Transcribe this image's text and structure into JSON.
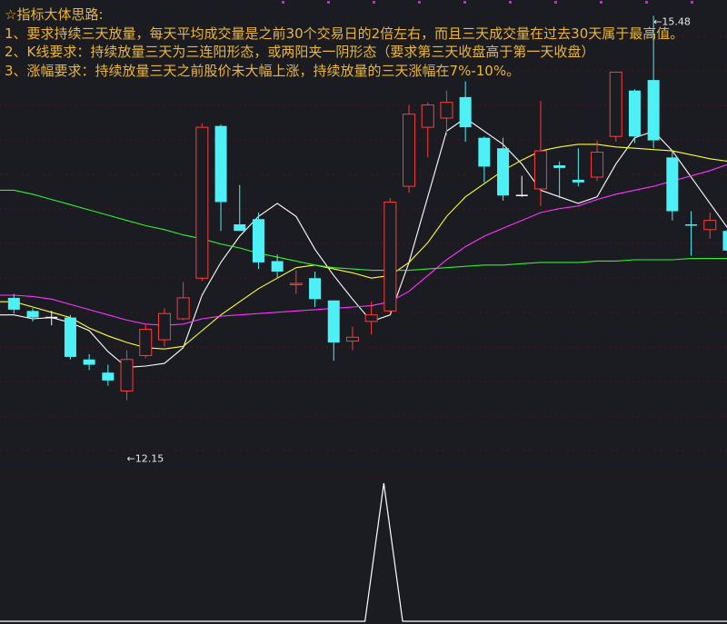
{
  "notes": {
    "title": "☆指标大体思路:",
    "line1": "1、要求持续三天放量，每天平均成交量是之前30个交易日的2倍左右，而且三天成交量在过去30天属于最高值。",
    "line2": "2、K线要求：持续放量三天为三连阳形态，或两阳夹一阴形态（要求第三天收盘高于第一天收盘）",
    "line3": "3、涨幅要求：持续放量三天之前股价未大幅上涨，持续放量的三天涨幅在7%-10%。"
  },
  "colors": {
    "background": "#1b1c21",
    "up": "#ff3b3b",
    "down": "#4df0f5",
    "text": "#e8b63a",
    "ma5": "#ffffff",
    "ma10": "#ffff33",
    "ma20": "#ff33ff",
    "ma60": "#33ee33",
    "grid": "#b01818"
  },
  "chart_data": [
    {
      "type": "candlestick",
      "ylim": [
        12.0,
        15.6
      ],
      "grid": true,
      "annotations": [
        {
          "label": "12.15",
          "value": 12.15,
          "candle": 6
        },
        {
          "label": "15.48",
          "value": 15.48,
          "candle": 34
        }
      ],
      "candles": [
        {
          "open": 13.33,
          "close": 13.24,
          "high": 13.36,
          "low": 13.21
        },
        {
          "open": 13.23,
          "close": 13.18,
          "high": 13.25,
          "low": 13.15
        },
        {
          "open": 13.18,
          "close": 13.18,
          "high": 13.23,
          "low": 13.12
        },
        {
          "open": 13.18,
          "close": 12.88,
          "high": 13.2,
          "low": 12.86
        },
        {
          "open": 12.86,
          "close": 12.82,
          "high": 12.9,
          "low": 12.78
        },
        {
          "open": 12.76,
          "close": 12.7,
          "high": 12.82,
          "low": 12.66
        },
        {
          "open": 12.62,
          "close": 12.86,
          "high": 12.93,
          "low": 12.55
        },
        {
          "open": 12.89,
          "close": 13.09,
          "high": 13.13,
          "low": 12.87
        },
        {
          "open": 13.01,
          "close": 13.21,
          "high": 13.25,
          "low": 12.96
        },
        {
          "open": 13.17,
          "close": 13.33,
          "high": 13.45,
          "low": 13.16
        },
        {
          "open": 13.48,
          "close": 14.63,
          "high": 14.66,
          "low": 13.46
        },
        {
          "open": 14.64,
          "close": 14.06,
          "high": 14.65,
          "low": 13.84
        },
        {
          "open": 13.89,
          "close": 13.84,
          "high": 14.19,
          "low": 13.84
        },
        {
          "open": 13.93,
          "close": 13.6,
          "high": 13.98,
          "low": 13.55
        },
        {
          "open": 13.61,
          "close": 13.53,
          "high": 13.66,
          "low": 13.48
        },
        {
          "open": 13.43,
          "close": 13.44,
          "high": 13.54,
          "low": 13.36
        },
        {
          "open": 13.48,
          "close": 13.32,
          "high": 13.53,
          "low": 13.26
        },
        {
          "open": 13.31,
          "close": 12.99,
          "high": 13.31,
          "low": 12.85
        },
        {
          "open": 13.0,
          "close": 13.03,
          "high": 13.11,
          "low": 12.93
        },
        {
          "open": 13.15,
          "close": 13.2,
          "high": 13.3,
          "low": 13.05
        },
        {
          "open": 13.23,
          "close": 14.06,
          "high": 14.09,
          "low": 13.22
        },
        {
          "open": 14.18,
          "close": 14.73,
          "high": 14.8,
          "low": 14.13
        },
        {
          "open": 14.63,
          "close": 14.8,
          "high": 14.82,
          "low": 14.4
        },
        {
          "open": 14.7,
          "close": 14.82,
          "high": 14.91,
          "low": 14.57
        },
        {
          "open": 14.86,
          "close": 14.63,
          "high": 14.98,
          "low": 14.52
        },
        {
          "open": 14.55,
          "close": 14.33,
          "high": 14.56,
          "low": 14.21
        },
        {
          "open": 14.47,
          "close": 14.11,
          "high": 14.55,
          "low": 14.07
        },
        {
          "open": 14.11,
          "close": 14.11,
          "high": 14.26,
          "low": 14.1
        },
        {
          "open": 14.16,
          "close": 14.45,
          "high": 14.83,
          "low": 14.03
        },
        {
          "open": 14.34,
          "close": 14.32,
          "high": 14.37,
          "low": 14.09
        },
        {
          "open": 14.23,
          "close": 14.21,
          "high": 14.47,
          "low": 14.18
        },
        {
          "open": 14.25,
          "close": 14.44,
          "high": 14.53,
          "low": 14.22
        },
        {
          "open": 14.56,
          "close": 15.05,
          "high": 15.05,
          "low": 14.52
        },
        {
          "open": 14.91,
          "close": 14.56,
          "high": 14.92,
          "low": 14.51
        },
        {
          "open": 14.99,
          "close": 14.53,
          "high": 15.48,
          "low": 14.47
        },
        {
          "open": 14.4,
          "close": 13.99,
          "high": 14.45,
          "low": 13.92
        },
        {
          "open": 13.89,
          "close": 13.88,
          "high": 13.99,
          "low": 13.65
        },
        {
          "open": 13.85,
          "close": 13.92,
          "high": 13.98,
          "low": 13.78
        },
        {
          "open": 13.84,
          "close": 13.69,
          "high": 13.9,
          "low": 13.54
        }
      ],
      "series": [
        {
          "type": "line",
          "color": "#ffffff",
          "values": [
            13.2,
            13.17,
            13.18,
            13.14,
            13.08,
            12.92,
            12.8,
            12.81,
            12.83,
            12.95,
            13.35,
            13.6,
            13.8,
            13.95,
            14.05,
            13.95,
            13.7,
            13.5,
            13.32,
            13.15,
            13.2,
            13.6,
            14.1,
            14.6,
            14.7,
            14.6,
            14.5,
            14.35,
            14.15,
            14.1,
            14.05,
            14.1,
            14.35,
            14.55,
            14.6,
            14.45,
            14.25,
            14.05,
            13.85
          ]
        },
        {
          "type": "line",
          "color": "#ffff33",
          "values": [
            13.3,
            13.26,
            13.22,
            13.18,
            13.1,
            13.04,
            12.99,
            12.95,
            12.94,
            12.96,
            13.08,
            13.2,
            13.3,
            13.4,
            13.48,
            13.56,
            13.58,
            13.55,
            13.52,
            13.48,
            13.5,
            13.6,
            13.75,
            13.95,
            14.1,
            14.2,
            14.3,
            14.38,
            14.45,
            14.48,
            14.5,
            14.5,
            14.48,
            14.47,
            14.46,
            14.45,
            14.42,
            14.39,
            14.37
          ]
        },
        {
          "type": "line",
          "color": "#ff33ff",
          "values": [
            13.35,
            13.34,
            13.32,
            13.28,
            13.24,
            13.2,
            13.16,
            13.13,
            13.12,
            13.13,
            13.17,
            13.19,
            13.2,
            13.21,
            13.22,
            13.23,
            13.24,
            13.25,
            13.26,
            13.27,
            13.3,
            13.38,
            13.5,
            13.62,
            13.72,
            13.8,
            13.86,
            13.92,
            13.98,
            14.01,
            14.03,
            14.08,
            14.12,
            14.15,
            14.18,
            14.22,
            14.26,
            14.3,
            14.35
          ]
        },
        {
          "type": "line",
          "color": "#33ee33",
          "values": [
            14.15,
            14.12,
            14.08,
            14.04,
            14.0,
            13.96,
            13.92,
            13.88,
            13.85,
            13.81,
            13.78,
            13.74,
            13.71,
            13.67,
            13.64,
            13.61,
            13.58,
            13.56,
            13.55,
            13.54,
            13.54,
            13.54,
            13.55,
            13.56,
            13.57,
            13.58,
            13.58,
            13.59,
            13.6,
            13.6,
            13.6,
            13.61,
            13.61,
            13.62,
            13.62,
            13.62,
            13.63,
            13.63,
            13.63
          ]
        }
      ]
    },
    {
      "type": "line",
      "ylim": [
        0,
        1
      ],
      "series": [
        {
          "color": "#ffffff",
          "values": [
            0,
            0,
            0,
            0,
            0,
            0,
            0,
            0,
            0,
            0,
            0,
            0,
            0,
            0,
            0,
            0,
            0,
            0,
            0,
            0,
            1,
            0,
            0,
            0,
            0,
            0,
            0,
            0,
            0,
            0,
            0,
            0,
            0,
            0,
            0,
            0,
            0,
            0,
            0
          ]
        }
      ]
    }
  ]
}
